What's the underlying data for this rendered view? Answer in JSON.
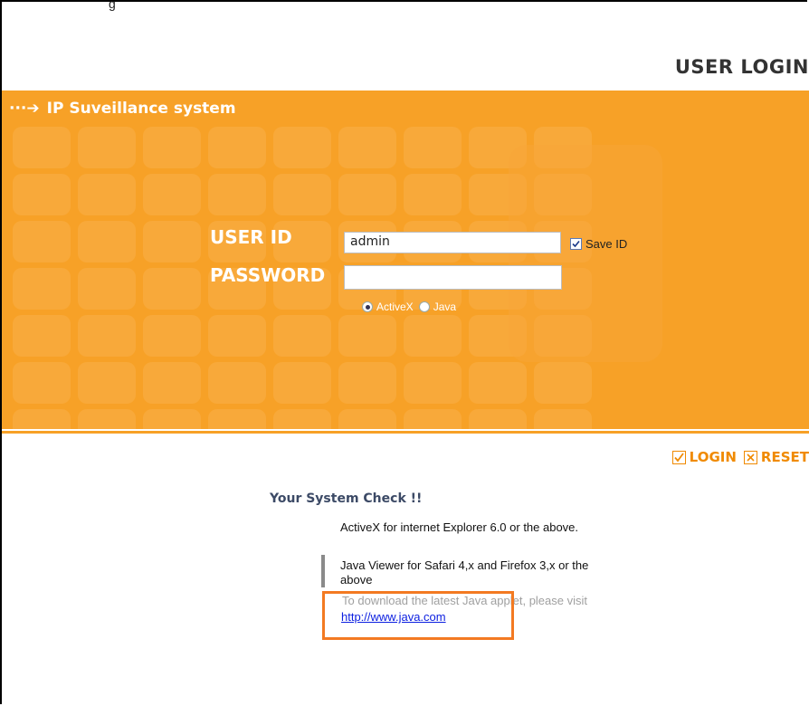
{
  "page": {
    "top_partial_text": "g",
    "title": "USER LOGIN"
  },
  "banner": {
    "header_text": "IP Suveillance system",
    "arrow_glyph": "···➔",
    "accent_color": "#f7a127"
  },
  "form": {
    "user_id_label": "USER ID",
    "user_id_value": "admin",
    "password_label": "PASSWORD",
    "password_value": "",
    "save_id_label": "Save ID",
    "save_id_checked": true,
    "radio_options": [
      {
        "label": "ActiveX",
        "selected": true
      },
      {
        "label": "Java",
        "selected": false
      }
    ]
  },
  "actions": {
    "login_label": "LOGIN",
    "reset_label": "RESET",
    "login_icon": "check-box-icon",
    "reset_icon": "x-box-icon"
  },
  "system_check": {
    "title": "Your System Check !!",
    "activex_text": "ActiveX for internet Explorer 6.0 or the above.",
    "java_viewer_line1": "Java Viewer for Safari 4,x and Firefox 3,x or the",
    "java_viewer_line2": "above",
    "download_text": "To download the latest Java applet, please visit",
    "java_link": "http://www.java.com"
  },
  "highlight_color": "#f37a22"
}
